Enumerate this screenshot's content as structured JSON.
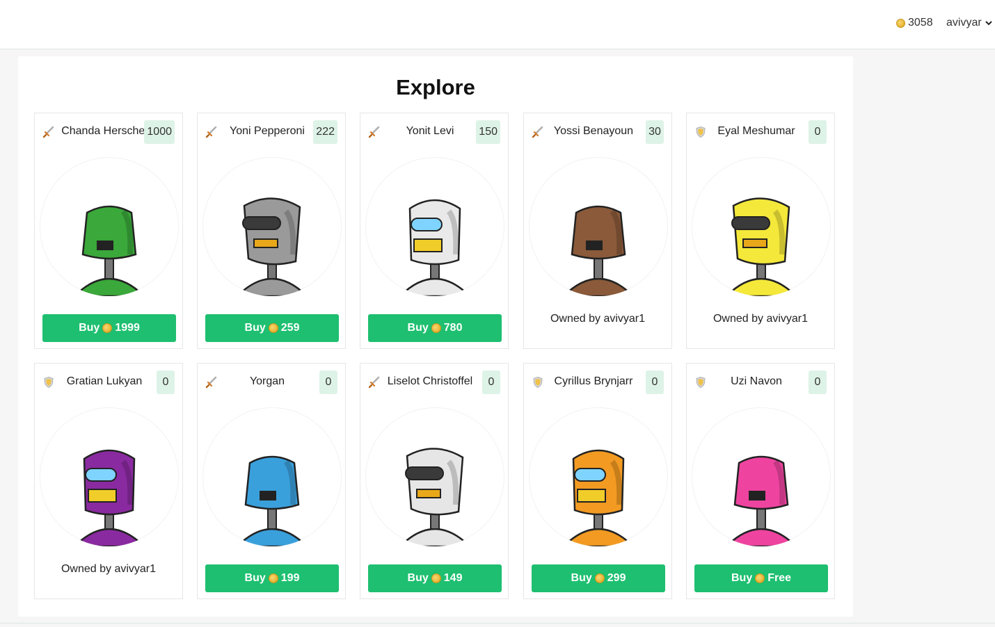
{
  "header": {
    "balance": "3058",
    "username": "avivyar"
  },
  "page": {
    "title": "Explore"
  },
  "cards": [
    {
      "name": "Chanda Herschel",
      "score": "1000",
      "role": "sword",
      "color": "#3aa83a",
      "status": "buy",
      "buy_label": "Buy",
      "price": "1999"
    },
    {
      "name": "Yoni Pepperoni",
      "score": "222",
      "role": "sword",
      "color": "#9a9a9a",
      "status": "buy",
      "buy_label": "Buy",
      "price": "259"
    },
    {
      "name": "Yonit Levi",
      "score": "150",
      "role": "sword",
      "color": "#e9e9e9",
      "status": "buy",
      "buy_label": "Buy",
      "price": "780"
    },
    {
      "name": "Yossi Benayoun",
      "score": "30",
      "role": "sword",
      "color": "#8a5a3a",
      "status": "owned",
      "owned_text": "Owned by avivyar1"
    },
    {
      "name": "Eyal Meshumar",
      "score": "0",
      "role": "shield",
      "color": "#f4e83a",
      "status": "owned",
      "owned_text": "Owned by avivyar1"
    },
    {
      "name": "Gratian Lukyan",
      "score": "0",
      "role": "shield",
      "color": "#8a2aa0",
      "status": "owned",
      "owned_text": "Owned by avivyar1"
    },
    {
      "name": "Yorgan",
      "score": "0",
      "role": "sword",
      "color": "#3aa0dc",
      "status": "buy",
      "buy_label": "Buy",
      "price": "199"
    },
    {
      "name": "Liselot Christoffel",
      "score": "0",
      "role": "sword",
      "color": "#e6e6e6",
      "status": "buy",
      "buy_label": "Buy",
      "price": "149"
    },
    {
      "name": "Cyrillus Brynjarr",
      "score": "0",
      "role": "shield",
      "color": "#f29a22",
      "status": "buy",
      "buy_label": "Buy",
      "price": "299"
    },
    {
      "name": "Uzi Navon",
      "score": "0",
      "role": "shield",
      "color": "#ee44a0",
      "status": "buy",
      "buy_label": "Buy",
      "price": "Free"
    }
  ]
}
